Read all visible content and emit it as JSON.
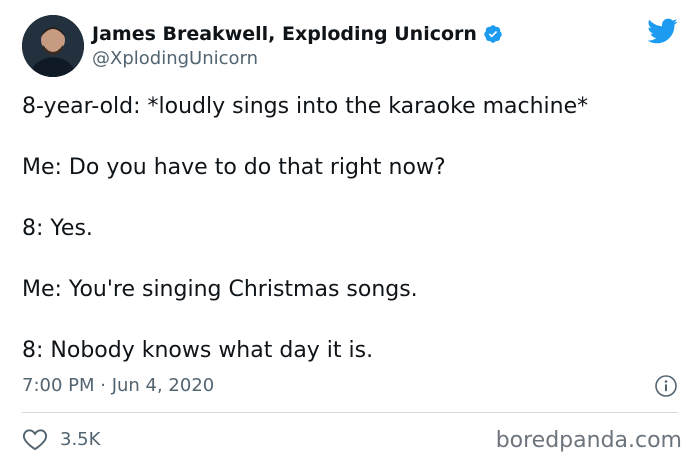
{
  "author": {
    "display_name": "James Breakwell, Exploding Unicorn",
    "handle": "@XplodingUnicorn",
    "verified": true,
    "avatar_icon": "profile-photo"
  },
  "tweet": {
    "lines": [
      "8-year-old: *loudly sings into the karaoke machine*",
      "Me: Do you have to do that right now?",
      "8: Yes.",
      "Me: You're singing Christmas songs.",
      "8: Nobody knows what day it is."
    ],
    "timestamp": "7:00 PM · Jun 4, 2020",
    "likes": "3.5K"
  },
  "watermark": "boredpanda.com",
  "icons": {
    "brand": "twitter-bird-icon",
    "verified": "verified-badge-icon",
    "info": "info-icon",
    "like": "heart-icon"
  },
  "colors": {
    "twitter_blue": "#1d9bf0",
    "text": "#0f1419",
    "secondary_text": "#536471",
    "divider": "#cfd9de"
  }
}
